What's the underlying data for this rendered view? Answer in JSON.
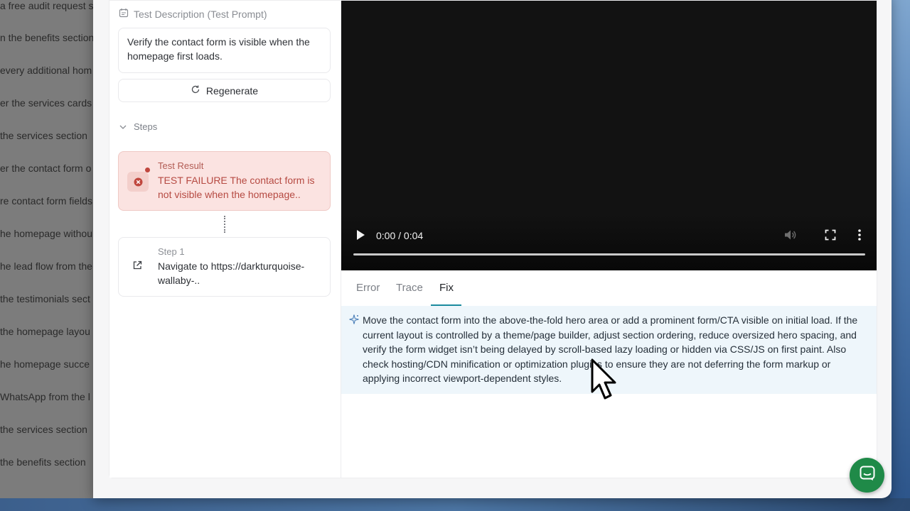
{
  "background_list": [
    "a free audit request s",
    "n the benefits section",
    "every additional hom",
    "er the services cards",
    "the services section",
    "er the contact form o",
    "re contact form fields",
    "he homepage withou",
    "he lead flow from the",
    "the testimonials sect",
    "the homepage layou",
    "he homepage succe",
    "WhatsApp from the l",
    "the services section",
    "the benefits section"
  ],
  "left_panel": {
    "description_heading": "Test Description (Test Prompt)",
    "description_text": "Verify the contact form is visible when the homepage first loads.",
    "regenerate_label": "Regenerate",
    "steps_label": "Steps",
    "result": {
      "label": "Test Result",
      "text": "TEST FAILURE The contact form is not visible when the homepage.."
    },
    "step1": {
      "label": "Step 1",
      "text": "Navigate to https://darkturquoise-wallaby-.."
    }
  },
  "video": {
    "time": "0:00 / 0:04",
    "progress": 0
  },
  "tabs": [
    "Error",
    "Trace",
    "Fix"
  ],
  "active_tab": "Fix",
  "fix_text": "Move the contact form into the above-the-fold hero area or add a prominent form/CTA visible on initial load. If the current layout is controlled by a theme/page builder, adjust section ordering, reduce oversized hero spacing, and verify the form widget isn’t being delayed by scroll-based lazy loading or hidden via CSS/JS on first paint. Also check hosting/CDN minification or optimization plugins to ensure they are not deferring the form markup or applying incorrect viewport-dependent styles.",
  "colors": {
    "accent": "#1a8a9e",
    "error_bg": "#fbe3e1",
    "error_text": "#b64a42",
    "fix_bg": "#eef6fb",
    "chat_button": "#1f8a48"
  }
}
